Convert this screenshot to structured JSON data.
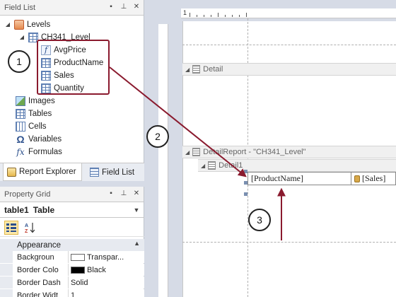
{
  "field_list": {
    "title": "Field List",
    "tree": [
      {
        "label": "Levels",
        "icon": "database-icon",
        "level": 0,
        "expanded": true
      },
      {
        "label": "CH341_Level",
        "icon": "table-icon",
        "level": 1,
        "expanded": true
      },
      {
        "label": "AvgPrice",
        "icon": "calculated-field-icon",
        "level": 2
      },
      {
        "label": "ProductName",
        "icon": "field-icon",
        "level": 2
      },
      {
        "label": "Sales",
        "icon": "field-icon",
        "level": 2
      },
      {
        "label": "Quantity",
        "icon": "field-icon",
        "level": 2
      },
      {
        "label": "Images",
        "icon": "images-icon",
        "level": 0
      },
      {
        "label": "Tables",
        "icon": "tables-icon",
        "level": 0
      },
      {
        "label": "Cells",
        "icon": "cells-icon",
        "level": 0
      },
      {
        "label": "Variables",
        "icon": "variables-icon",
        "level": 0
      },
      {
        "label": "Formulas",
        "icon": "formulas-icon",
        "level": 0
      }
    ],
    "tabs": [
      {
        "label": "Report Explorer",
        "active": true
      },
      {
        "label": "Field List",
        "active": false
      }
    ]
  },
  "property_grid": {
    "title": "Property Grid",
    "selected": {
      "name": "table1",
      "type": "Table"
    },
    "category": "Appearance",
    "rows": [
      {
        "name": "Backgroun",
        "value": "Transpar...",
        "swatch": "#ffffff"
      },
      {
        "name": "Border Colo",
        "value": "Black",
        "swatch": "#000000"
      },
      {
        "name": "Border Dash",
        "value": "Solid"
      },
      {
        "name": "Border Widt",
        "value": "1"
      }
    ]
  },
  "designer": {
    "ruler_start": "1",
    "bands": {
      "detail": "Detail",
      "detail_report": "DetailReport - \"CH341_Level\"",
      "detail1": "Detail1"
    },
    "table_cells": [
      "[ProductName]",
      "[Sales]"
    ]
  },
  "callouts": [
    "1",
    "2",
    "3"
  ],
  "colors": {
    "highlight": "#8a1a2e",
    "accent": "#fce8a8"
  }
}
